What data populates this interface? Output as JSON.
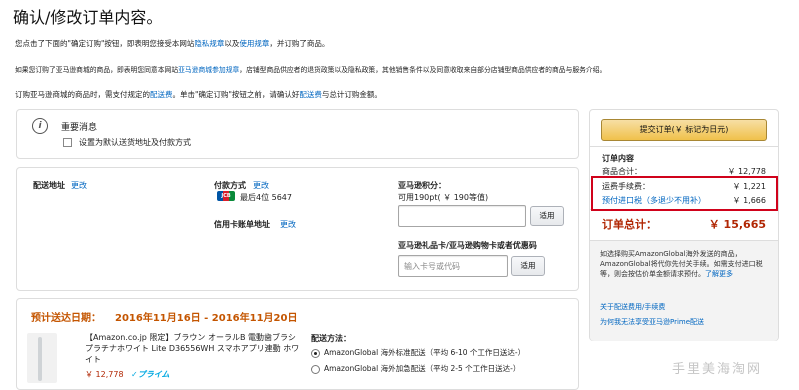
{
  "page": {
    "title": "确认/修改订单内容。",
    "notice1": {
      "before": "您点击了下面的\"确定订购\"按钮，即表明您接受本网站",
      "link1": "隐私规章",
      "mid": "以及",
      "link2": "使用规章",
      "after": "，并订购了商品。"
    },
    "notice2": {
      "before": "如果您订购了亚马逊商城的商品，即表明您同意本网站",
      "link": "亚马逊商城参加规章",
      "after": "，店铺型商品供应者的退货政策以及隐私政策，其他销售条件以及同意收取来自部分店铺型商品供应者的商品与服务介绍。"
    },
    "notice3": {
      "before": "订购亚马逊商城的商品时，需支付规定的",
      "link1": "配送费",
      "mid": "。单击\"确定订购\"按钮之前，请确认好",
      "link2": "配送费",
      "after": "与总计订购金额。"
    }
  },
  "important": {
    "title": "重要消息",
    "checkbox_label": "设置为默认送货地址及付款方式"
  },
  "address": {
    "label": "配送地址",
    "change": "更改"
  },
  "payment": {
    "label": "付款方式",
    "change": "更改",
    "card_brand": "JCB",
    "card_text": "最后4位 5647",
    "billing_label": "信用卡账单地址",
    "billing_change": "更改"
  },
  "points": {
    "title": "亚马逊积分：",
    "available": "可用190pt( ￥ 190等值)",
    "apply": "适用"
  },
  "giftcard": {
    "title": "亚马逊礼品卡/亚马逊购物卡或者优惠码",
    "placeholder": "输入卡号或代码",
    "apply": "适用"
  },
  "delivery": {
    "date_label": "预计送达日期：",
    "date_value": "2016年11月16日 - 2016年11月20日",
    "product_name": "【Amazon.co.jp 限定】ブラウン オーラルB 電動歯ブラシ プラチナホワイト Lite D36556WH スマホアプリ連動 ホワイト",
    "product_price": "￥ 12,778",
    "prime": "✓プライム",
    "method_label": "配送方法：",
    "options": [
      "AmazonGlobal 海外标准配送（平均 6-10 个工作日送达-）",
      "AmazonGlobal 海外加急配送（平均 2-5 个工作日送达-）"
    ]
  },
  "summary": {
    "place_order": "提交订单(￥ 标记为日元)",
    "heading": "订单内容",
    "rows": [
      {
        "label": "商品合计：",
        "value": "￥ 12,778"
      },
      {
        "label": "运费手续费：",
        "value": "￥ 1,221"
      },
      {
        "label": "预付进口税（多退少不用补）",
        "value": "￥ 1,666"
      }
    ],
    "total_label": "订单总计：",
    "total_value": "￥ 15,665",
    "info": "如选择购买AmazonGlobal海外发送的商品，AmazonGlobal将代你先付关手续。如需支付进口税等，则会按估价单金额请求预付。",
    "info_link": "了解更多",
    "link1": "关于配送费用/手续费",
    "link2": "为何我无法享受亚马逊Prime配送"
  },
  "watermark": "手里美海淘网",
  "colors": {
    "highlight": "#d0021b",
    "orange": "#c45500",
    "link": "#0066c0",
    "price": "#b12704"
  }
}
